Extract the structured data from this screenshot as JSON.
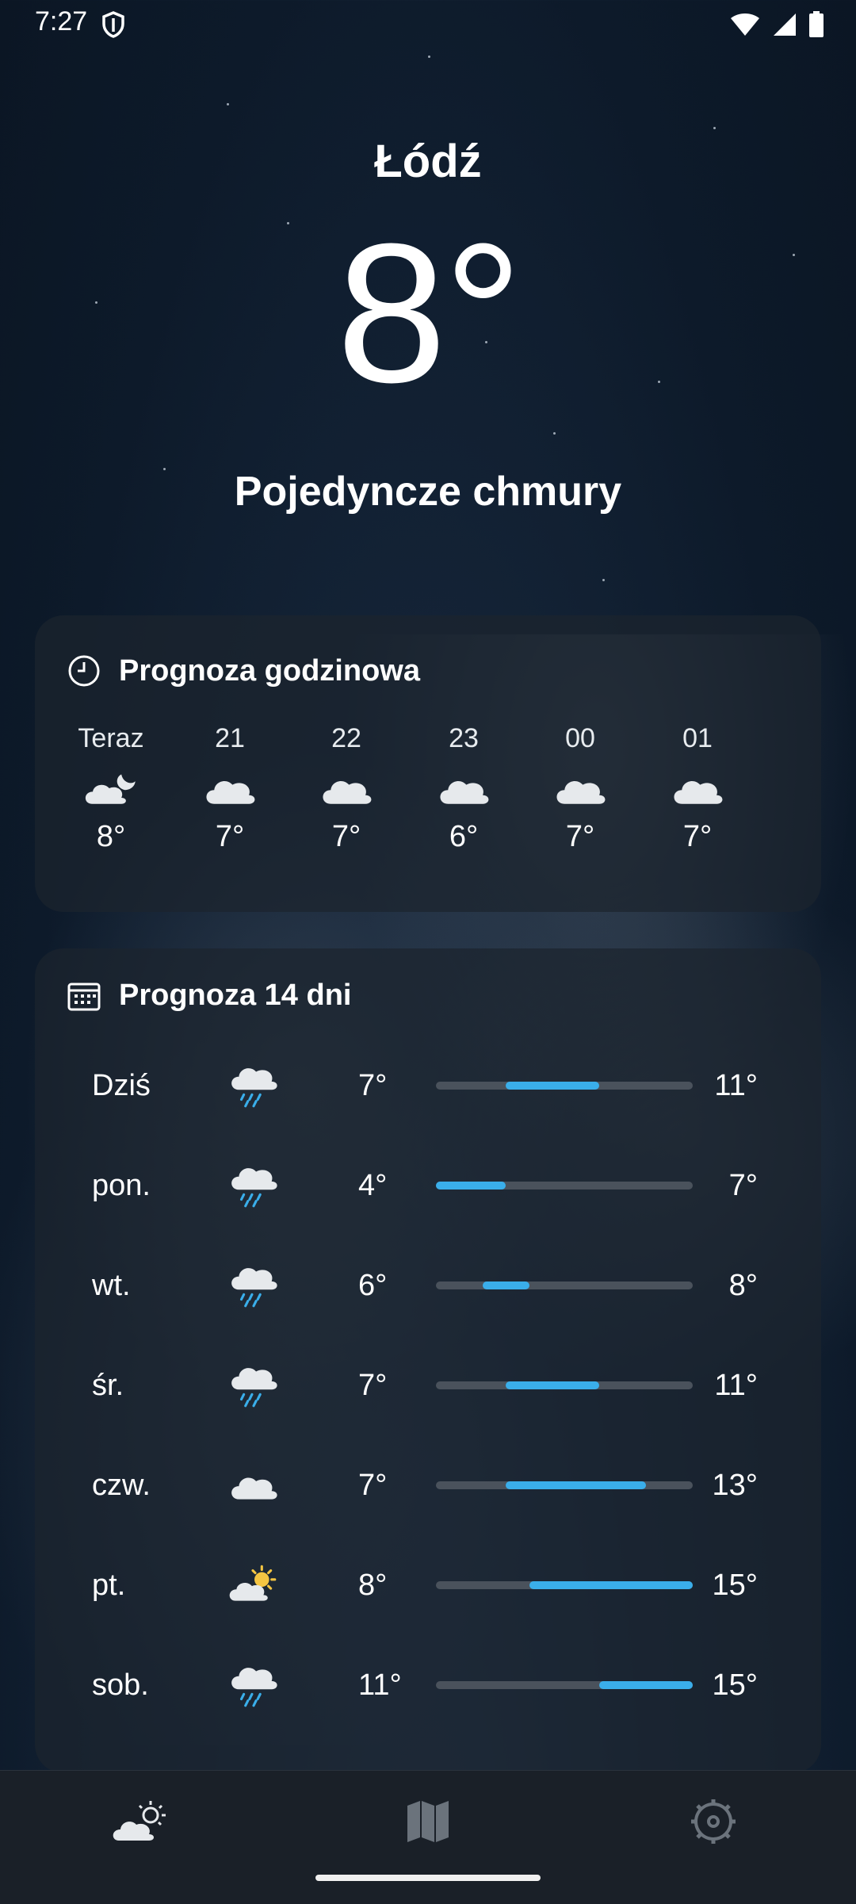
{
  "status": {
    "time": "7:27"
  },
  "location": {
    "city": "Łódź"
  },
  "current": {
    "temperature": "8°",
    "condition": "Pojedyncze chmury"
  },
  "hourly": {
    "title": "Prognoza godzinowa",
    "items": [
      {
        "label": "Teraz",
        "icon": "night-partly-cloudy-icon",
        "temp": "8°"
      },
      {
        "label": "21",
        "icon": "cloud-icon",
        "temp": "7°"
      },
      {
        "label": "22",
        "icon": "cloud-icon",
        "temp": "7°"
      },
      {
        "label": "23",
        "icon": "cloud-icon",
        "temp": "6°"
      },
      {
        "label": "00",
        "icon": "cloud-icon",
        "temp": "7°"
      },
      {
        "label": "01",
        "icon": "cloud-icon",
        "temp": "7°"
      }
    ]
  },
  "daily": {
    "title": "Prognoza 14 dni",
    "range_min": 4,
    "range_max": 15,
    "items": [
      {
        "day": "Dziś",
        "icon": "rain-cloud-icon",
        "min": "7°",
        "max": "11°",
        "min_val": 7,
        "max_val": 11
      },
      {
        "day": "pon.",
        "icon": "rain-cloud-icon",
        "min": "4°",
        "max": "7°",
        "min_val": 4,
        "max_val": 7
      },
      {
        "day": "wt.",
        "icon": "rain-cloud-icon",
        "min": "6°",
        "max": "8°",
        "min_val": 6,
        "max_val": 8
      },
      {
        "day": "śr.",
        "icon": "rain-cloud-icon",
        "min": "7°",
        "max": "11°",
        "min_val": 7,
        "max_val": 11
      },
      {
        "day": "czw.",
        "icon": "cloud-icon",
        "min": "7°",
        "max": "13°",
        "min_val": 7,
        "max_val": 13
      },
      {
        "day": "pt.",
        "icon": "partly-sunny-icon",
        "min": "8°",
        "max": "15°",
        "min_val": 8,
        "max_val": 15
      },
      {
        "day": "sob.",
        "icon": "rain-cloud-icon",
        "min": "11°",
        "max": "15°",
        "min_val": 11,
        "max_val": 15
      }
    ]
  },
  "nav": {
    "items": [
      {
        "name": "weather-nav-icon",
        "active": true
      },
      {
        "name": "map-nav-icon",
        "active": false
      },
      {
        "name": "settings-nav-icon",
        "active": false
      }
    ]
  },
  "colors": {
    "accent": "#3aaeea",
    "track": "#4a525c",
    "card": "#1c242e",
    "navbar": "#1a2028"
  }
}
